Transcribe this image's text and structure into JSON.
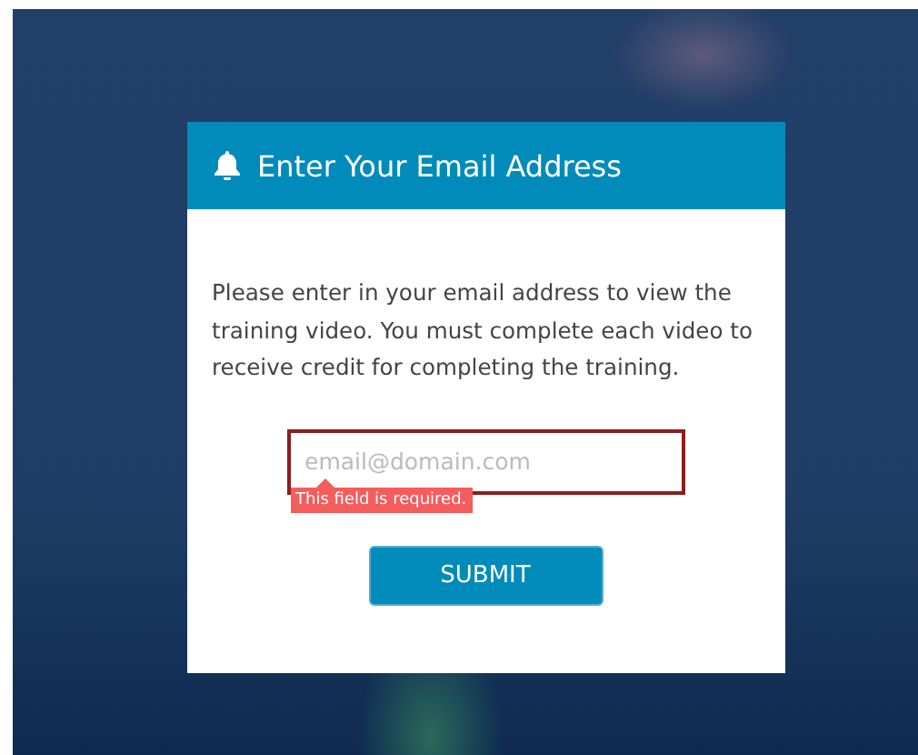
{
  "dialog": {
    "title": "Enter Your Email Address",
    "message": "Please enter in your email address to view the training video. You must complete each video to receive credit for completing the training.",
    "email_field": {
      "placeholder": "email@domain.com",
      "error": "This field is required."
    },
    "submit_button": "SUBMIT"
  }
}
